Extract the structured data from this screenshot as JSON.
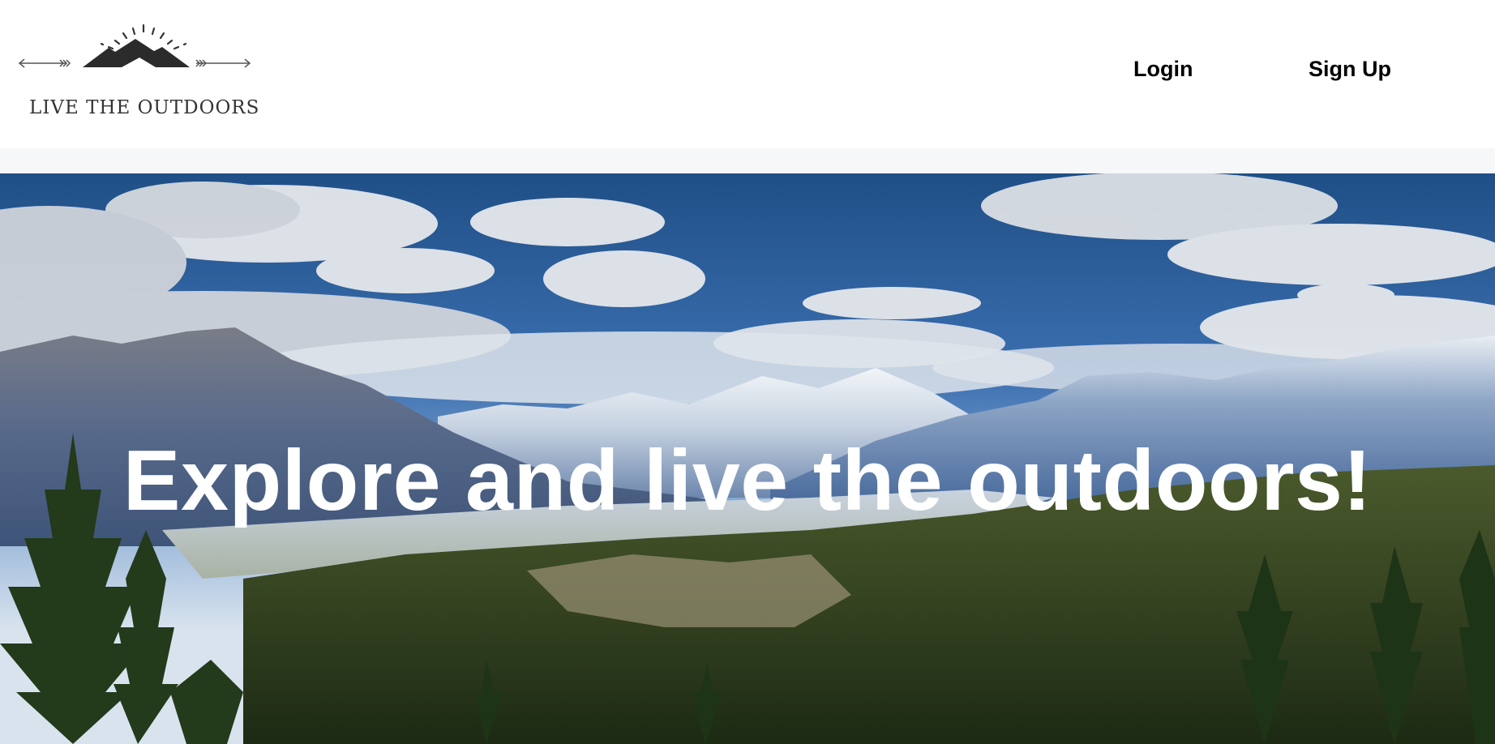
{
  "brand": {
    "name": "LIVE THE OUTDOORS",
    "logo_icon": "mountain-sun-arrows-icon"
  },
  "nav": {
    "login_label": "Login",
    "signup_label": "Sign Up"
  },
  "hero": {
    "title": "Explore and live the outdoors!",
    "background_image": "mountain-valley-landscape"
  },
  "colors": {
    "header_bg": "#ffffff",
    "band_bg": "#f6f7f8",
    "hero_text": "#ffffff",
    "nav_text": "#000000",
    "logo_ink": "#333333"
  }
}
